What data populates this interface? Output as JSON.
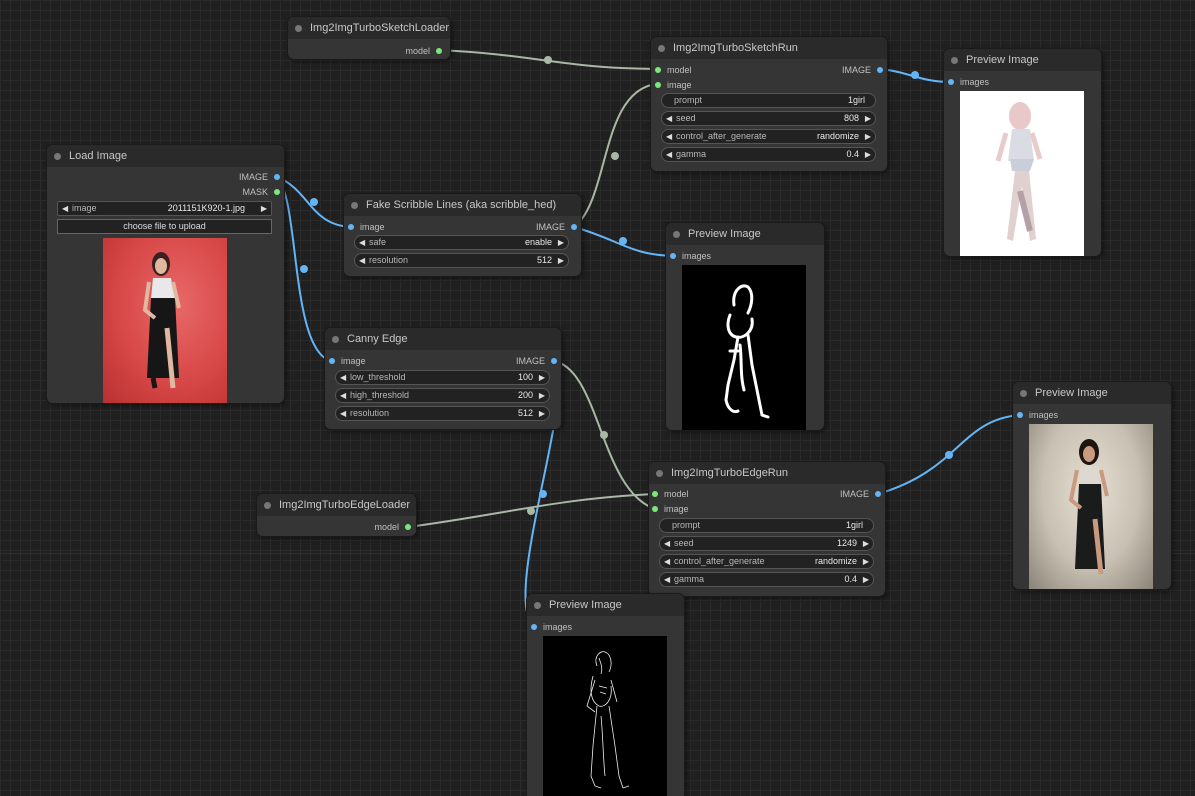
{
  "nodes": {
    "sketch_loader": {
      "title": "Img2ImgTurboSketchLoader",
      "out_model": "model"
    },
    "sketch_run": {
      "title": "Img2ImgTurboSketchRun",
      "in_model": "model",
      "in_image": "image",
      "out_image": "IMAGE",
      "prompt_label": "prompt",
      "prompt_value": "1girl",
      "seed_label": "seed",
      "seed_value": "808",
      "control_label": "control_after_generate",
      "control_value": "randomize",
      "gamma_label": "gamma",
      "gamma_value": "0.4"
    },
    "preview_top_right": {
      "title": "Preview Image",
      "in_images": "images"
    },
    "load_image": {
      "title": "Load Image",
      "out_image": "IMAGE",
      "out_mask": "MASK",
      "image_label": "image",
      "image_value": "2011151K920-1.jpg",
      "upload_label": "choose file to upload"
    },
    "fake_scribble": {
      "title": "Fake Scribble Lines (aka scribble_hed)",
      "in_image": "image",
      "out_image": "IMAGE",
      "safe_label": "safe",
      "safe_value": "enable",
      "resolution_label": "resolution",
      "resolution_value": "512"
    },
    "preview_scribble": {
      "title": "Preview Image",
      "in_images": "images"
    },
    "canny_edge": {
      "title": "Canny Edge",
      "in_image": "image",
      "out_image": "IMAGE",
      "low_label": "low_threshold",
      "low_value": "100",
      "high_label": "high_threshold",
      "high_value": "200",
      "resolution_label": "resolution",
      "resolution_value": "512"
    },
    "preview_edge_result": {
      "title": "Preview Image",
      "in_images": "images"
    },
    "edge_loader": {
      "title": "Img2ImgTurboEdgeLoader",
      "out_model": "model"
    },
    "edge_run": {
      "title": "Img2ImgTurboEdgeRun",
      "in_model": "model",
      "in_image": "image",
      "out_image": "IMAGE",
      "prompt_label": "prompt",
      "prompt_value": "1girl",
      "seed_label": "seed",
      "seed_value": "1249",
      "control_label": "control_after_generate",
      "control_value": "randomize",
      "gamma_label": "gamma",
      "gamma_value": "0.4"
    },
    "preview_canny": {
      "title": "Preview Image",
      "in_images": "images"
    }
  },
  "colors": {
    "canvas": "#202020",
    "node": "#353535",
    "link_image": "#64b5f6",
    "link_model": "#a9b8a4",
    "pin_model": "#7ce87c"
  },
  "icons": {
    "arrow_left": "◀",
    "arrow_right": "▶"
  }
}
